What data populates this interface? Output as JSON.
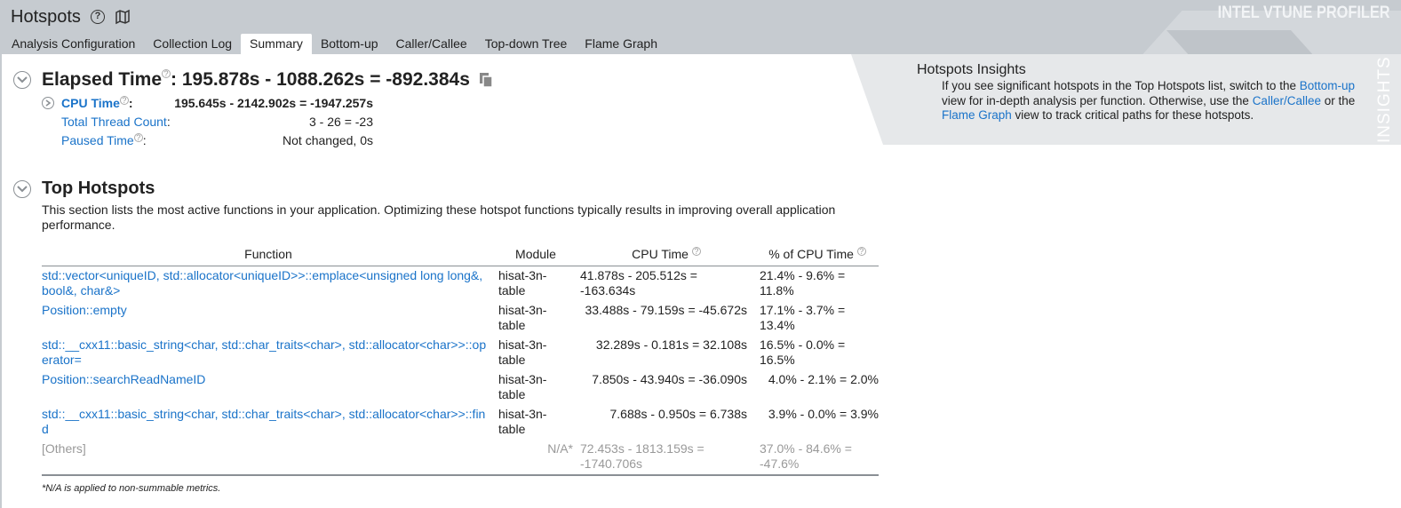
{
  "header": {
    "title": "Hotspots",
    "brand": "INTEL VTUNE PROFILER"
  },
  "tabs": [
    {
      "label": "Analysis Configuration"
    },
    {
      "label": "Collection Log"
    },
    {
      "label": "Summary",
      "active": true
    },
    {
      "label": "Bottom-up"
    },
    {
      "label": "Caller/Callee"
    },
    {
      "label": "Top-down Tree"
    },
    {
      "label": "Flame Graph"
    }
  ],
  "elapsed": {
    "label": "Elapsed Time",
    "value": ": 195.878s - 1088.262s = -892.384s",
    "metrics": [
      {
        "label": "CPU Time",
        "suffix": ":",
        "value": "195.645s - 2142.902s = -1947.257s"
      },
      {
        "label": "Total Thread Count",
        "suffix": ":",
        "value": "3 - 26 = -23"
      },
      {
        "label": "Paused Time",
        "suffix": ":",
        "value": "Not changed, 0s"
      }
    ]
  },
  "insights": {
    "side_label": "INSIGHTS",
    "title": "Hotspots Insights",
    "text_1": "If you see significant hotspots in the Top Hotspots list, switch to the ",
    "link_bottom_up": "Bottom-up",
    "text_2": " view for in-depth analysis per function. Otherwise, use the ",
    "link_caller_callee": "Caller/Callee",
    "text_3": " or the ",
    "link_flame_graph": "Flame Graph",
    "text_4": " view to track critical paths for these hotspots."
  },
  "top_hotspots": {
    "title": "Top Hotspots",
    "description": "This section lists the most active functions in your application. Optimizing these hotspot functions typically results in improving overall application performance.",
    "columns": {
      "function": "Function",
      "module": "Module",
      "cpu_time": "CPU Time",
      "pct_cpu_time": "% of CPU Time"
    },
    "rows": [
      {
        "function": "std::vector<uniqueID, std::allocator<uniqueID>>::emplace<unsigned long long&, bool&, char&>",
        "module": "hisat-3n-table",
        "cpu_time": "41.878s - 205.512s = -163.634s",
        "pct": "21.4% - 9.6% = 11.8%"
      },
      {
        "function": "Position::empty",
        "module": "hisat-3n-table",
        "cpu_time": "33.488s - 79.159s = -45.672s",
        "pct": "17.1% - 3.7% = 13.4%"
      },
      {
        "function": "std::__cxx11::basic_string<char, std::char_traits<char>, std::allocator<char>>::operator=",
        "module": "hisat-3n-table",
        "cpu_time": "32.289s - 0.181s = 32.108s",
        "pct": "16.5% - 0.0% = 16.5%"
      },
      {
        "function": "Position::searchReadNameID",
        "module": "hisat-3n-table",
        "cpu_time": "7.850s - 43.940s = -36.090s",
        "pct": "4.0% - 2.1% = 2.0%"
      },
      {
        "function": "std::__cxx11::basic_string<char, std::char_traits<char>, std::allocator<char>>::find",
        "module": "hisat-3n-table",
        "cpu_time": "7.688s - 0.950s = 6.738s",
        "pct": "3.9% - 0.0% = 3.9%"
      }
    ],
    "others": {
      "function": "[Others]",
      "module": "N/A*",
      "cpu_time": "72.453s - 1813.159s = -1740.706s",
      "pct": "37.0% - 84.6% = -47.6%"
    },
    "footnote": "*N/A is applied to non-summable metrics."
  },
  "colors": {
    "link": "#1a73c9",
    "topbar": "#c6cbd0",
    "insights_bg": "#e6e8ea"
  }
}
